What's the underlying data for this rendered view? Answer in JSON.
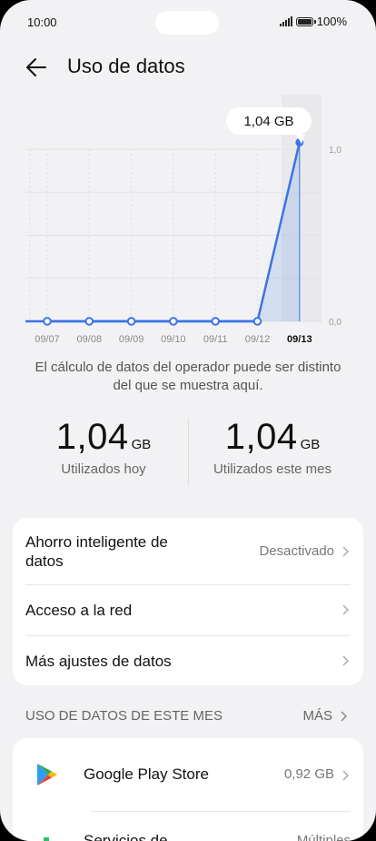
{
  "status": {
    "time": "10:00",
    "battery": "100%"
  },
  "header": {
    "title": "Uso de datos"
  },
  "chart_data": {
    "type": "area",
    "categories": [
      "09/07",
      "09/08",
      "09/09",
      "09/10",
      "09/11",
      "09/12",
      "09/13"
    ],
    "values": [
      0,
      0,
      0,
      0,
      0,
      0,
      1.04
    ],
    "ylim": [
      0,
      1.0
    ],
    "yticks": [
      "1,0",
      "0,0"
    ],
    "selected_category": "09/13",
    "tooltip": "1,04 GB",
    "color": "#3b74e6"
  },
  "disclaimer": "El cálculo de datos del operador puede ser distinto del que se muestra aquí.",
  "usage": {
    "today": {
      "value": "1,04",
      "unit": "GB",
      "label": "Utilizados hoy"
    },
    "month": {
      "value": "1,04",
      "unit": "GB",
      "label": "Utilizados este mes"
    }
  },
  "settings": {
    "smart_saver": {
      "label": "Ahorro inteligente de datos",
      "value": "Desactivado"
    },
    "network_access": {
      "label": "Acceso a la red"
    },
    "more_settings": {
      "label": "Más ajustes de datos"
    }
  },
  "section": {
    "title": "USO DE DATOS DE ESTE MES",
    "more": "MÁS"
  },
  "apps": [
    {
      "name": "Google Play Store",
      "value": "0,92 GB",
      "icon": "play-store-icon"
    },
    {
      "name": "Servicios de",
      "value": "Múltiples",
      "icon": "services-icon"
    }
  ]
}
